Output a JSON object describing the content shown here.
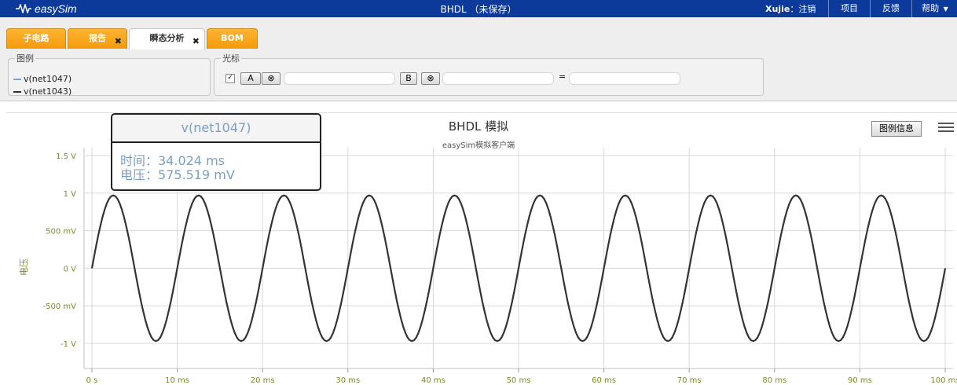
{
  "app": {
    "logo_text": "easySim",
    "doc_title": "BHDL （未保存）",
    "user_name": "Xujie",
    "logout": "：注销",
    "menu": [
      "项目",
      "反馈",
      "帮助"
    ]
  },
  "tabs": [
    {
      "label": "子电路",
      "closable": false,
      "active": false
    },
    {
      "label": "报告",
      "closable": true,
      "active": false
    },
    {
      "label": "瞬态分析",
      "closable": true,
      "active": true
    },
    {
      "label": "BOM",
      "closable": false,
      "active": false
    }
  ],
  "legend_panel": {
    "title": "图例",
    "items": [
      {
        "label": "v(net1047)",
        "color": "#7aa6d6"
      },
      {
        "label": "v(net1043)",
        "color": "#333333"
      }
    ]
  },
  "cursor_panel": {
    "title": "光标",
    "checked": true,
    "button_a": "A",
    "button_b": "B",
    "clear_icon": "⊗",
    "equals": "="
  },
  "chart_data": {
    "type": "line",
    "title": "BHDL 模拟",
    "subtitle": "easySim模拟客户端",
    "ylabel": "电压",
    "xlim": [
      0,
      100
    ],
    "ylim": [
      -1.5,
      1.5
    ],
    "x_unit": "ms",
    "x_ticks": [
      "0 s",
      "10 ms",
      "20 ms",
      "30 ms",
      "40 ms",
      "50 ms",
      "60 ms",
      "70 ms",
      "80 ms",
      "90 ms",
      "100 ms"
    ],
    "y_ticks": [
      {
        "value": 1.5,
        "label": "1.5 V"
      },
      {
        "value": 1,
        "label": "1 V"
      },
      {
        "value": 0.5,
        "label": "500 mV"
      },
      {
        "value": 0,
        "label": "0 V"
      },
      {
        "value": -0.5,
        "label": "-500 mV"
      },
      {
        "value": -1,
        "label": "-1 V"
      }
    ],
    "grid": true,
    "series": [
      {
        "name": "v(net1043)",
        "color": "#333333",
        "amplitude": 0.97,
        "frequency_hz": 100,
        "phase": 0
      }
    ],
    "tooltip": {
      "series": "v(net1047)",
      "time_label": "时间：34.024 ms",
      "voltage_label": "电压：575.519 mV"
    },
    "legend_button": "图例信息"
  }
}
